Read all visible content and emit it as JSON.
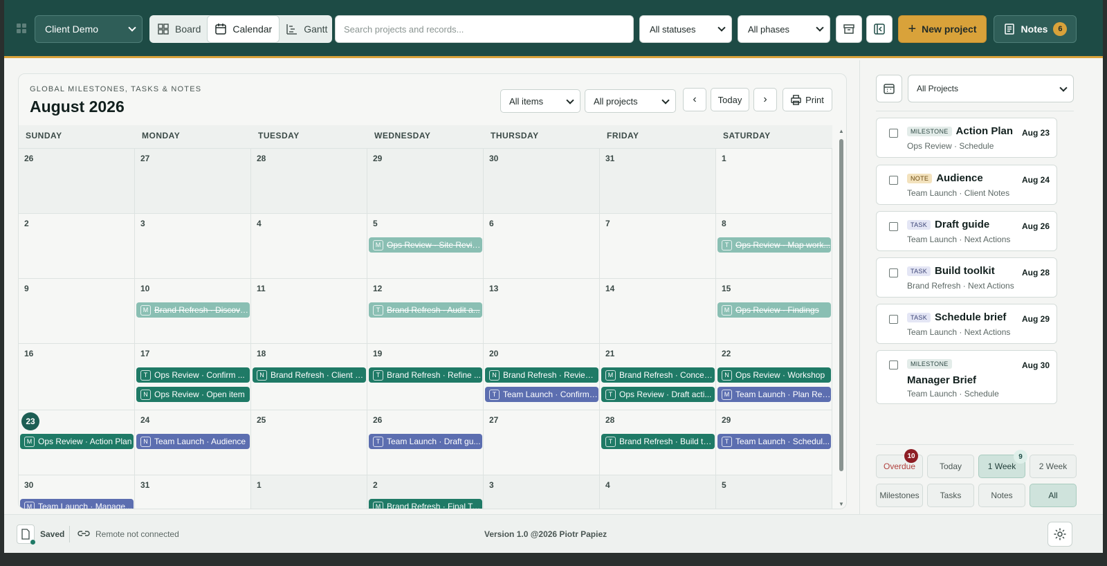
{
  "topbar": {
    "workspace": "Client Demo",
    "views": [
      "Board",
      "Calendar",
      "Gantt"
    ],
    "active_view": "Calendar",
    "search_placeholder": "Search projects and records...",
    "status_filter": "All statuses",
    "phase_filter": "All phases",
    "new_project_label": "New project",
    "notes_label": "Notes",
    "notes_count": "6"
  },
  "calendar": {
    "kicker": "GLOBAL MILESTONES, TASKS & NOTES",
    "month": "August 2026",
    "items_filter": "All items",
    "projects_filter": "All projects",
    "today_label": "Today",
    "print_label": "Print",
    "weekdays": [
      "SUNDAY",
      "MONDAY",
      "TUESDAY",
      "WEDNESDAY",
      "THURSDAY",
      "FRIDAY",
      "SATURDAY"
    ],
    "weeks": [
      [
        {
          "d": "26",
          "o": true
        },
        {
          "d": "27",
          "o": true
        },
        {
          "d": "28",
          "o": true
        },
        {
          "d": "29",
          "o": true
        },
        {
          "d": "30",
          "o": true
        },
        {
          "d": "31",
          "o": true
        },
        {
          "d": "1"
        }
      ],
      [
        {
          "d": "2"
        },
        {
          "d": "3"
        },
        {
          "d": "4"
        },
        {
          "d": "5"
        },
        {
          "d": "6"
        },
        {
          "d": "7"
        },
        {
          "d": "8"
        }
      ],
      [
        {
          "d": "9"
        },
        {
          "d": "10"
        },
        {
          "d": "11"
        },
        {
          "d": "12"
        },
        {
          "d": "13"
        },
        {
          "d": "14"
        },
        {
          "d": "15"
        }
      ],
      [
        {
          "d": "16"
        },
        {
          "d": "17"
        },
        {
          "d": "18"
        },
        {
          "d": "19"
        },
        {
          "d": "20"
        },
        {
          "d": "21"
        },
        {
          "d": "22"
        }
      ],
      [
        {
          "d": "23",
          "today": true
        },
        {
          "d": "24"
        },
        {
          "d": "25"
        },
        {
          "d": "26"
        },
        {
          "d": "27"
        },
        {
          "d": "28"
        },
        {
          "d": "29"
        }
      ],
      [
        {
          "d": "30"
        },
        {
          "d": "31"
        },
        {
          "d": "1",
          "o": true
        },
        {
          "d": "2",
          "o": true
        },
        {
          "d": "3",
          "o": true
        },
        {
          "d": "4",
          "o": true
        },
        {
          "d": "5",
          "o": true
        }
      ]
    ],
    "events": [
      {
        "week": 1,
        "day": 3,
        "slot": 0,
        "tag": "M",
        "text": "Ops Review · Site Review",
        "style": "done"
      },
      {
        "week": 1,
        "day": 6,
        "slot": 0,
        "tag": "T",
        "text": "Ops Review · Map work...",
        "style": "done"
      },
      {
        "week": 2,
        "day": 1,
        "slot": 0,
        "tag": "M",
        "text": "Brand Refresh · Discove...",
        "style": "done"
      },
      {
        "week": 2,
        "day": 3,
        "slot": 0,
        "tag": "T",
        "text": "Brand Refresh · Audit a...",
        "style": "done"
      },
      {
        "week": 2,
        "day": 6,
        "slot": 0,
        "tag": "M",
        "text": "Ops Review · Findings",
        "style": "done"
      },
      {
        "week": 3,
        "day": 1,
        "slot": 0,
        "tag": "T",
        "text": "Ops Review · Confirm ...",
        "style": "green"
      },
      {
        "week": 3,
        "day": 1,
        "slot": 1,
        "tag": "N",
        "text": "Ops Review · Open item",
        "style": "green"
      },
      {
        "week": 3,
        "day": 2,
        "slot": 0,
        "tag": "N",
        "text": "Brand Refresh · Client d...",
        "style": "green"
      },
      {
        "week": 3,
        "day": 3,
        "slot": 0,
        "tag": "T",
        "text": "Brand Refresh · Refine ...",
        "style": "green"
      },
      {
        "week": 3,
        "day": 4,
        "slot": 0,
        "tag": "N",
        "text": "Brand Refresh · Review ...",
        "style": "green"
      },
      {
        "week": 3,
        "day": 4,
        "slot": 1,
        "tag": "T",
        "text": "Team Launch · Confirm ...",
        "style": "blue"
      },
      {
        "week": 3,
        "day": 5,
        "slot": 0,
        "tag": "M",
        "text": "Brand Refresh · Concep...",
        "style": "green"
      },
      {
        "week": 3,
        "day": 5,
        "slot": 1,
        "tag": "T",
        "text": "Ops Review · Draft acti...",
        "style": "green"
      },
      {
        "week": 3,
        "day": 6,
        "slot": 0,
        "tag": "N",
        "text": "Ops Review · Workshop",
        "style": "green"
      },
      {
        "week": 3,
        "day": 6,
        "slot": 1,
        "tag": "M",
        "text": "Team Launch · Plan Rea...",
        "style": "blue"
      },
      {
        "week": 4,
        "day": 0,
        "slot": 0,
        "tag": "M",
        "text": "Ops Review · Action Plan",
        "style": "green"
      },
      {
        "week": 4,
        "day": 1,
        "slot": 0,
        "tag": "N",
        "text": "Team Launch · Audience",
        "style": "blue"
      },
      {
        "week": 4,
        "day": 3,
        "slot": 0,
        "tag": "T",
        "text": "Team Launch · Draft gu...",
        "style": "blue"
      },
      {
        "week": 4,
        "day": 5,
        "slot": 0,
        "tag": "T",
        "text": "Brand Refresh · Build to...",
        "style": "green"
      },
      {
        "week": 4,
        "day": 6,
        "slot": 0,
        "tag": "T",
        "text": "Team Launch · Schedul...",
        "style": "blue"
      },
      {
        "week": 5,
        "day": 0,
        "slot": 0,
        "tag": "M",
        "text": "Team Launch · Manage...",
        "style": "blue"
      },
      {
        "week": 5,
        "day": 3,
        "slot": 0,
        "tag": "M",
        "text": "Brand Refresh · Final To...",
        "style": "green"
      }
    ]
  },
  "sidebar": {
    "project_filter": "All Projects",
    "agenda": [
      {
        "pill": "MILESTONE",
        "kind": "ms",
        "title": "Action Plan",
        "sub": "Ops Review · Schedule",
        "date": "Aug 23"
      },
      {
        "pill": "NOTE",
        "kind": "note",
        "title": "Audience",
        "sub": "Team Launch · Client Notes",
        "date": "Aug 24"
      },
      {
        "pill": "TASK",
        "kind": "task",
        "title": "Draft guide",
        "sub": "Team Launch · Next Actions",
        "date": "Aug 26"
      },
      {
        "pill": "TASK",
        "kind": "task",
        "title": "Build toolkit",
        "sub": "Brand Refresh · Next Actions",
        "date": "Aug 28"
      },
      {
        "pill": "TASK",
        "kind": "task",
        "title": "Schedule brief",
        "sub": "Team Launch · Next Actions",
        "date": "Aug 29"
      },
      {
        "pill": "MILESTONE",
        "kind": "ms",
        "title": "Manager Brief",
        "sub": "Team Launch · Schedule",
        "date": "Aug 30"
      }
    ],
    "range_buttons": [
      "Overdue",
      "Today",
      "1 Week",
      "2 Week"
    ],
    "overdue_count": "10",
    "week_count": "9",
    "type_buttons": [
      "Milestones",
      "Tasks",
      "Notes",
      "All"
    ]
  },
  "footer": {
    "saved_label": "Saved",
    "remote_label": "Remote not connected",
    "version": "Version 1.0 @2026 Piotr Papiez"
  },
  "colors": {
    "brand": "#1d4b45",
    "accent": "#d9a23a",
    "event_green": "#1f7a66",
    "event_blue": "#5c6eb0"
  }
}
